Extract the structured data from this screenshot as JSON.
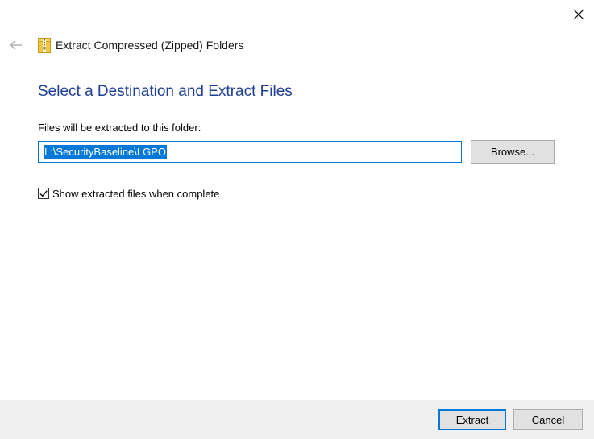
{
  "window": {
    "title": "Extract Compressed (Zipped) Folders",
    "close_icon": "close-icon",
    "back_icon": "back-arrow-icon",
    "title_icon": "zip-folder-icon"
  },
  "main": {
    "heading": "Select a Destination and Extract Files",
    "destination_label": "Files will be extracted to this folder:",
    "destination_value": "L:\\SecurityBaseline\\LGPO",
    "browse_label": "Browse...",
    "show_files_label": "Show extracted files when complete",
    "show_files_checked": true
  },
  "footer": {
    "extract_label": "Extract",
    "cancel_label": "Cancel"
  },
  "colors": {
    "heading": "#1f3f97",
    "accent": "#0078d7",
    "footer_bg": "#f0f0f0",
    "button_bg": "#e1e1e1"
  }
}
